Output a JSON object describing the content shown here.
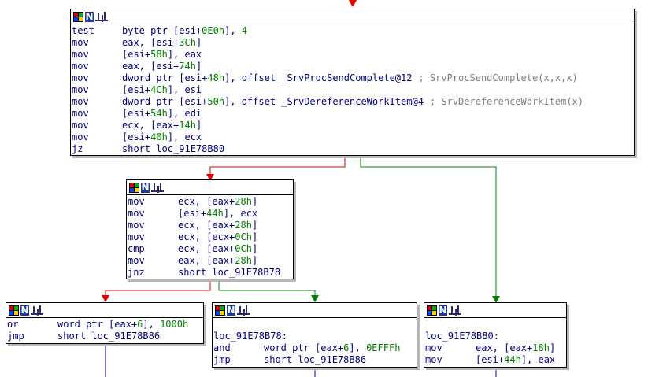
{
  "graph": {
    "node1": {
      "lines": [
        {
          "mn": "test",
          "ops": [
            {
              "t": "byte ptr [esi+"
            },
            {
              "t": "0E0h",
              "n": 1
            },
            {
              "t": "], "
            },
            {
              "t": "4",
              "n": 1
            }
          ]
        },
        {
          "mn": "mov",
          "ops": [
            {
              "t": "eax, [esi+"
            },
            {
              "t": "3Ch",
              "n": 1
            },
            {
              "t": "]"
            }
          ]
        },
        {
          "mn": "mov",
          "ops": [
            {
              "t": "[esi+"
            },
            {
              "t": "58h",
              "n": 1
            },
            {
              "t": "], eax"
            }
          ]
        },
        {
          "mn": "mov",
          "ops": [
            {
              "t": "eax, [esi+"
            },
            {
              "t": "74h",
              "n": 1
            },
            {
              "t": "]"
            }
          ]
        },
        {
          "mn": "mov",
          "ops": [
            {
              "t": "dword ptr [esi+"
            },
            {
              "t": "48h",
              "n": 1
            },
            {
              "t": "], offset _SrvProcSendComplete@12"
            }
          ],
          "comment": "; SrvProcSendComplete(x,x,x)"
        },
        {
          "mn": "mov",
          "ops": [
            {
              "t": "[esi+"
            },
            {
              "t": "4Ch",
              "n": 1
            },
            {
              "t": "], esi"
            }
          ]
        },
        {
          "mn": "mov",
          "ops": [
            {
              "t": "dword ptr [esi+"
            },
            {
              "t": "50h",
              "n": 1
            },
            {
              "t": "], offset _SrvDereferenceWorkItem@4"
            }
          ],
          "comment": "; SrvDereferenceWorkItem(x)"
        },
        {
          "mn": "mov",
          "ops": [
            {
              "t": "[esi+"
            },
            {
              "t": "54h",
              "n": 1
            },
            {
              "t": "], edi"
            }
          ]
        },
        {
          "mn": "mov",
          "ops": [
            {
              "t": "ecx, [eax+"
            },
            {
              "t": "14h",
              "n": 1
            },
            {
              "t": "]"
            }
          ]
        },
        {
          "mn": "mov",
          "ops": [
            {
              "t": "[esi+"
            },
            {
              "t": "40h",
              "n": 1
            },
            {
              "t": "], ecx"
            }
          ]
        },
        {
          "mn": "jz",
          "ops": [
            {
              "t": "short loc_91E78B80"
            }
          ]
        }
      ]
    },
    "node2": {
      "lines": [
        {
          "mn": "mov",
          "ops": [
            {
              "t": "ecx, [eax+"
            },
            {
              "t": "28h",
              "n": 1
            },
            {
              "t": "]"
            }
          ]
        },
        {
          "mn": "mov",
          "ops": [
            {
              "t": "[esi+"
            },
            {
              "t": "44h",
              "n": 1
            },
            {
              "t": "], ecx"
            }
          ]
        },
        {
          "mn": "mov",
          "ops": [
            {
              "t": "ecx, [eax+"
            },
            {
              "t": "28h",
              "n": 1
            },
            {
              "t": "]"
            }
          ]
        },
        {
          "mn": "mov",
          "ops": [
            {
              "t": "ecx, [ecx+"
            },
            {
              "t": "0Ch",
              "n": 1
            },
            {
              "t": "]"
            }
          ]
        },
        {
          "mn": "cmp",
          "ops": [
            {
              "t": "ecx, [eax+"
            },
            {
              "t": "0Ch",
              "n": 1
            },
            {
              "t": "]"
            }
          ]
        },
        {
          "mn": "mov",
          "ops": [
            {
              "t": "eax, [eax+"
            },
            {
              "t": "28h",
              "n": 1
            },
            {
              "t": "]"
            }
          ]
        },
        {
          "mn": "jnz",
          "ops": [
            {
              "t": "short loc_91E78B78"
            }
          ]
        }
      ]
    },
    "node3": {
      "lines": [
        {
          "mn": "or",
          "ops": [
            {
              "t": "word ptr [eax+"
            },
            {
              "t": "6",
              "n": 1
            },
            {
              "t": "], "
            },
            {
              "t": "1000h",
              "n": 1
            }
          ]
        },
        {
          "mn": "jmp",
          "ops": [
            {
              "t": "short loc_91E78B86"
            }
          ]
        }
      ]
    },
    "node4": {
      "lines": [
        {
          "label": ""
        },
        {
          "label": "loc_91E78B78:"
        },
        {
          "mn": "and",
          "ops": [
            {
              "t": "word ptr [eax+"
            },
            {
              "t": "6",
              "n": 1
            },
            {
              "t": "], "
            },
            {
              "t": "0EFFFh",
              "n": 1
            }
          ]
        },
        {
          "mn": "jmp",
          "ops": [
            {
              "t": "short loc_91E78B86"
            }
          ]
        }
      ]
    },
    "node5": {
      "lines": [
        {
          "label": ""
        },
        {
          "label": "loc_91E78B80:"
        },
        {
          "mn": "mov",
          "ops": [
            {
              "t": "eax, [eax+"
            },
            {
              "t": "18h",
              "n": 1
            },
            {
              "t": "]"
            }
          ]
        },
        {
          "mn": "mov",
          "ops": [
            {
              "t": "[esi+"
            },
            {
              "t": "44h",
              "n": 1
            },
            {
              "t": "], eax"
            }
          ]
        }
      ]
    }
  },
  "colors": {
    "text": "#000080",
    "number": "#008000",
    "comment": "#808080",
    "edge_true": "#008000",
    "edge_false": "#e00000",
    "edge_jump": "#0000c0"
  },
  "icons": [
    "node-color-icon",
    "node-n-icon",
    "node-graph-icon"
  ]
}
